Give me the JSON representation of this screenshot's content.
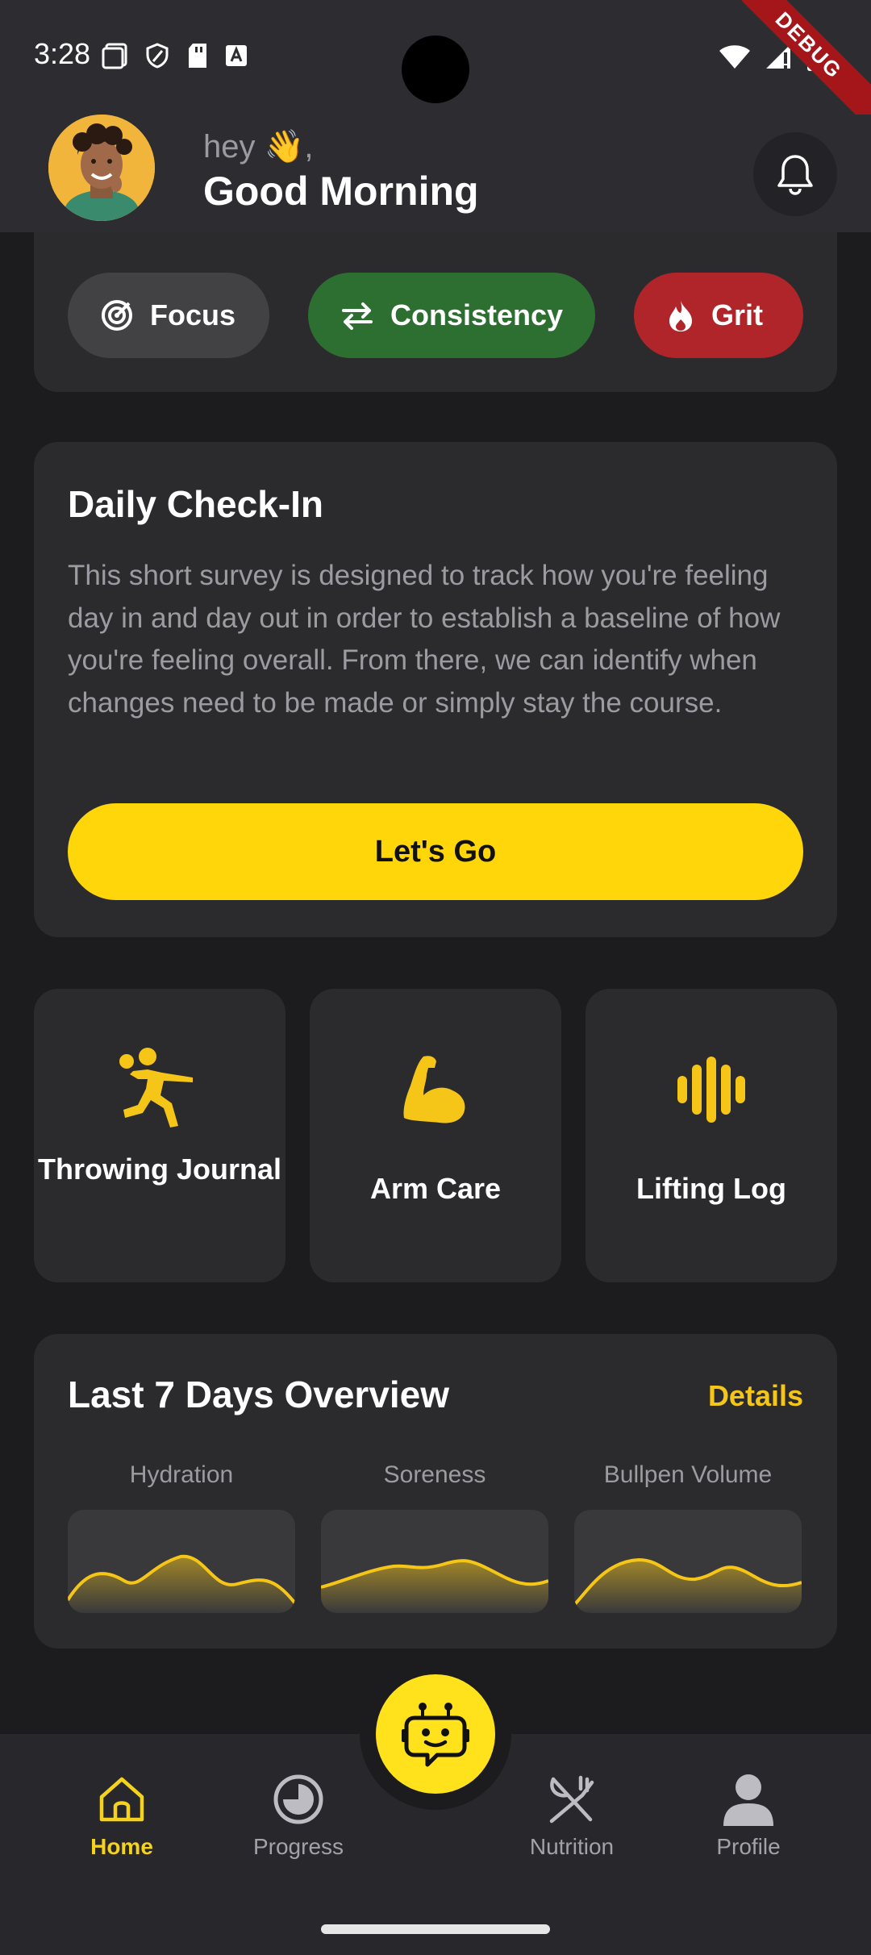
{
  "status_bar": {
    "time": "3:28",
    "debug_label": "DEBUG",
    "icons_left": [
      "screen-icon",
      "shield-icon",
      "sd-card-icon",
      "font-icon"
    ],
    "icons_right": [
      "wifi-icon",
      "signal-icon",
      "battery-icon"
    ]
  },
  "header": {
    "greeting_small": "hey 👋,",
    "greeting_big": "Good Morning",
    "avatar_icon": "avatar",
    "bell_icon": "bell-icon"
  },
  "traits": [
    {
      "label": "Focus",
      "icon": "target-icon",
      "color": "#424244"
    },
    {
      "label": "Consistency",
      "icon": "repeat-arrows-icon",
      "color": "#2d6f31"
    },
    {
      "label": "Grit",
      "icon": "flame-icon",
      "color": "#b0252a"
    }
  ],
  "checkin": {
    "title": "Daily Check-In",
    "body": "This short survey is designed to track how you're feeling day in and day out in order to establish a baseline of how you're feeling overall. From there, we can identify when changes need to be made or simply stay the course.",
    "button_label": "Let's Go"
  },
  "tiles": [
    {
      "label": "Throwing Journal",
      "icon": "throwing-player-icon"
    },
    {
      "label": "Arm Care",
      "icon": "flexed-bicep-icon"
    },
    {
      "label": "Lifting Log",
      "icon": "dumbbell-bars-icon"
    }
  ],
  "overview": {
    "title": "Last 7 Days Overview",
    "details_label": "Details",
    "metrics": [
      {
        "label": "Hydration"
      },
      {
        "label": "Soreness"
      },
      {
        "label": "Bullpen Volume"
      }
    ]
  },
  "nav": {
    "items": [
      {
        "label": "Home",
        "icon": "home-icon",
        "active": true
      },
      {
        "label": "Progress",
        "icon": "progress-pie-icon",
        "active": false
      },
      {
        "label": "Nutrition",
        "icon": "fork-knife-icon",
        "active": false
      },
      {
        "label": "Profile",
        "icon": "person-icon",
        "active": false
      }
    ],
    "fab_icon": "robot-chat-icon"
  },
  "colors": {
    "accent": "#ffd60a",
    "background": "#1c1c1e",
    "card": "#2b2b2e",
    "header": "#2d2c31"
  }
}
